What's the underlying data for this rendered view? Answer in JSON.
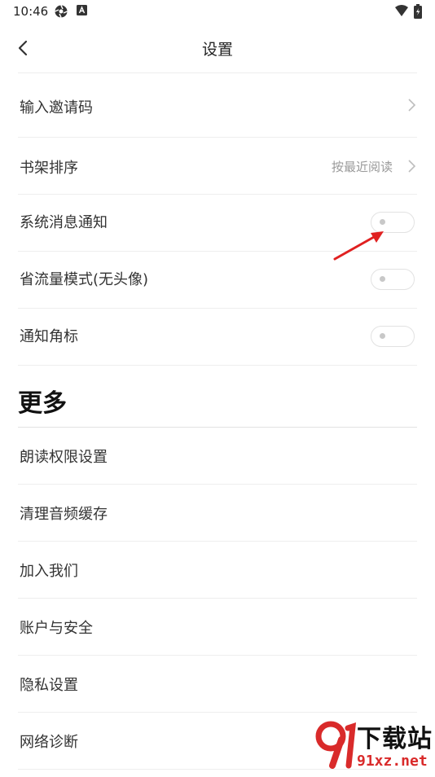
{
  "status": {
    "time": "10:46"
  },
  "header": {
    "title": "设置"
  },
  "settings": [
    {
      "label": "输入邀请码"
    },
    {
      "label": "书架排序",
      "value": "按最近阅读"
    },
    {
      "label": "系统消息通知",
      "toggle": "off"
    },
    {
      "label": "省流量模式(无头像)",
      "toggle": "off"
    },
    {
      "label": "通知角标",
      "toggle": "off"
    }
  ],
  "more": {
    "title": "更多",
    "items": [
      {
        "label": "朗读权限设置"
      },
      {
        "label": "清理音频缓存"
      },
      {
        "label": "加入我们"
      },
      {
        "label": "账户与安全"
      },
      {
        "label": "隐私设置"
      },
      {
        "label": "网络诊断"
      }
    ]
  },
  "watermark": {
    "text": "下载站",
    "domain": "91xz.net"
  },
  "colors": {
    "annotation_arrow": "#e02020",
    "watermark_red": "#d92a2a"
  }
}
